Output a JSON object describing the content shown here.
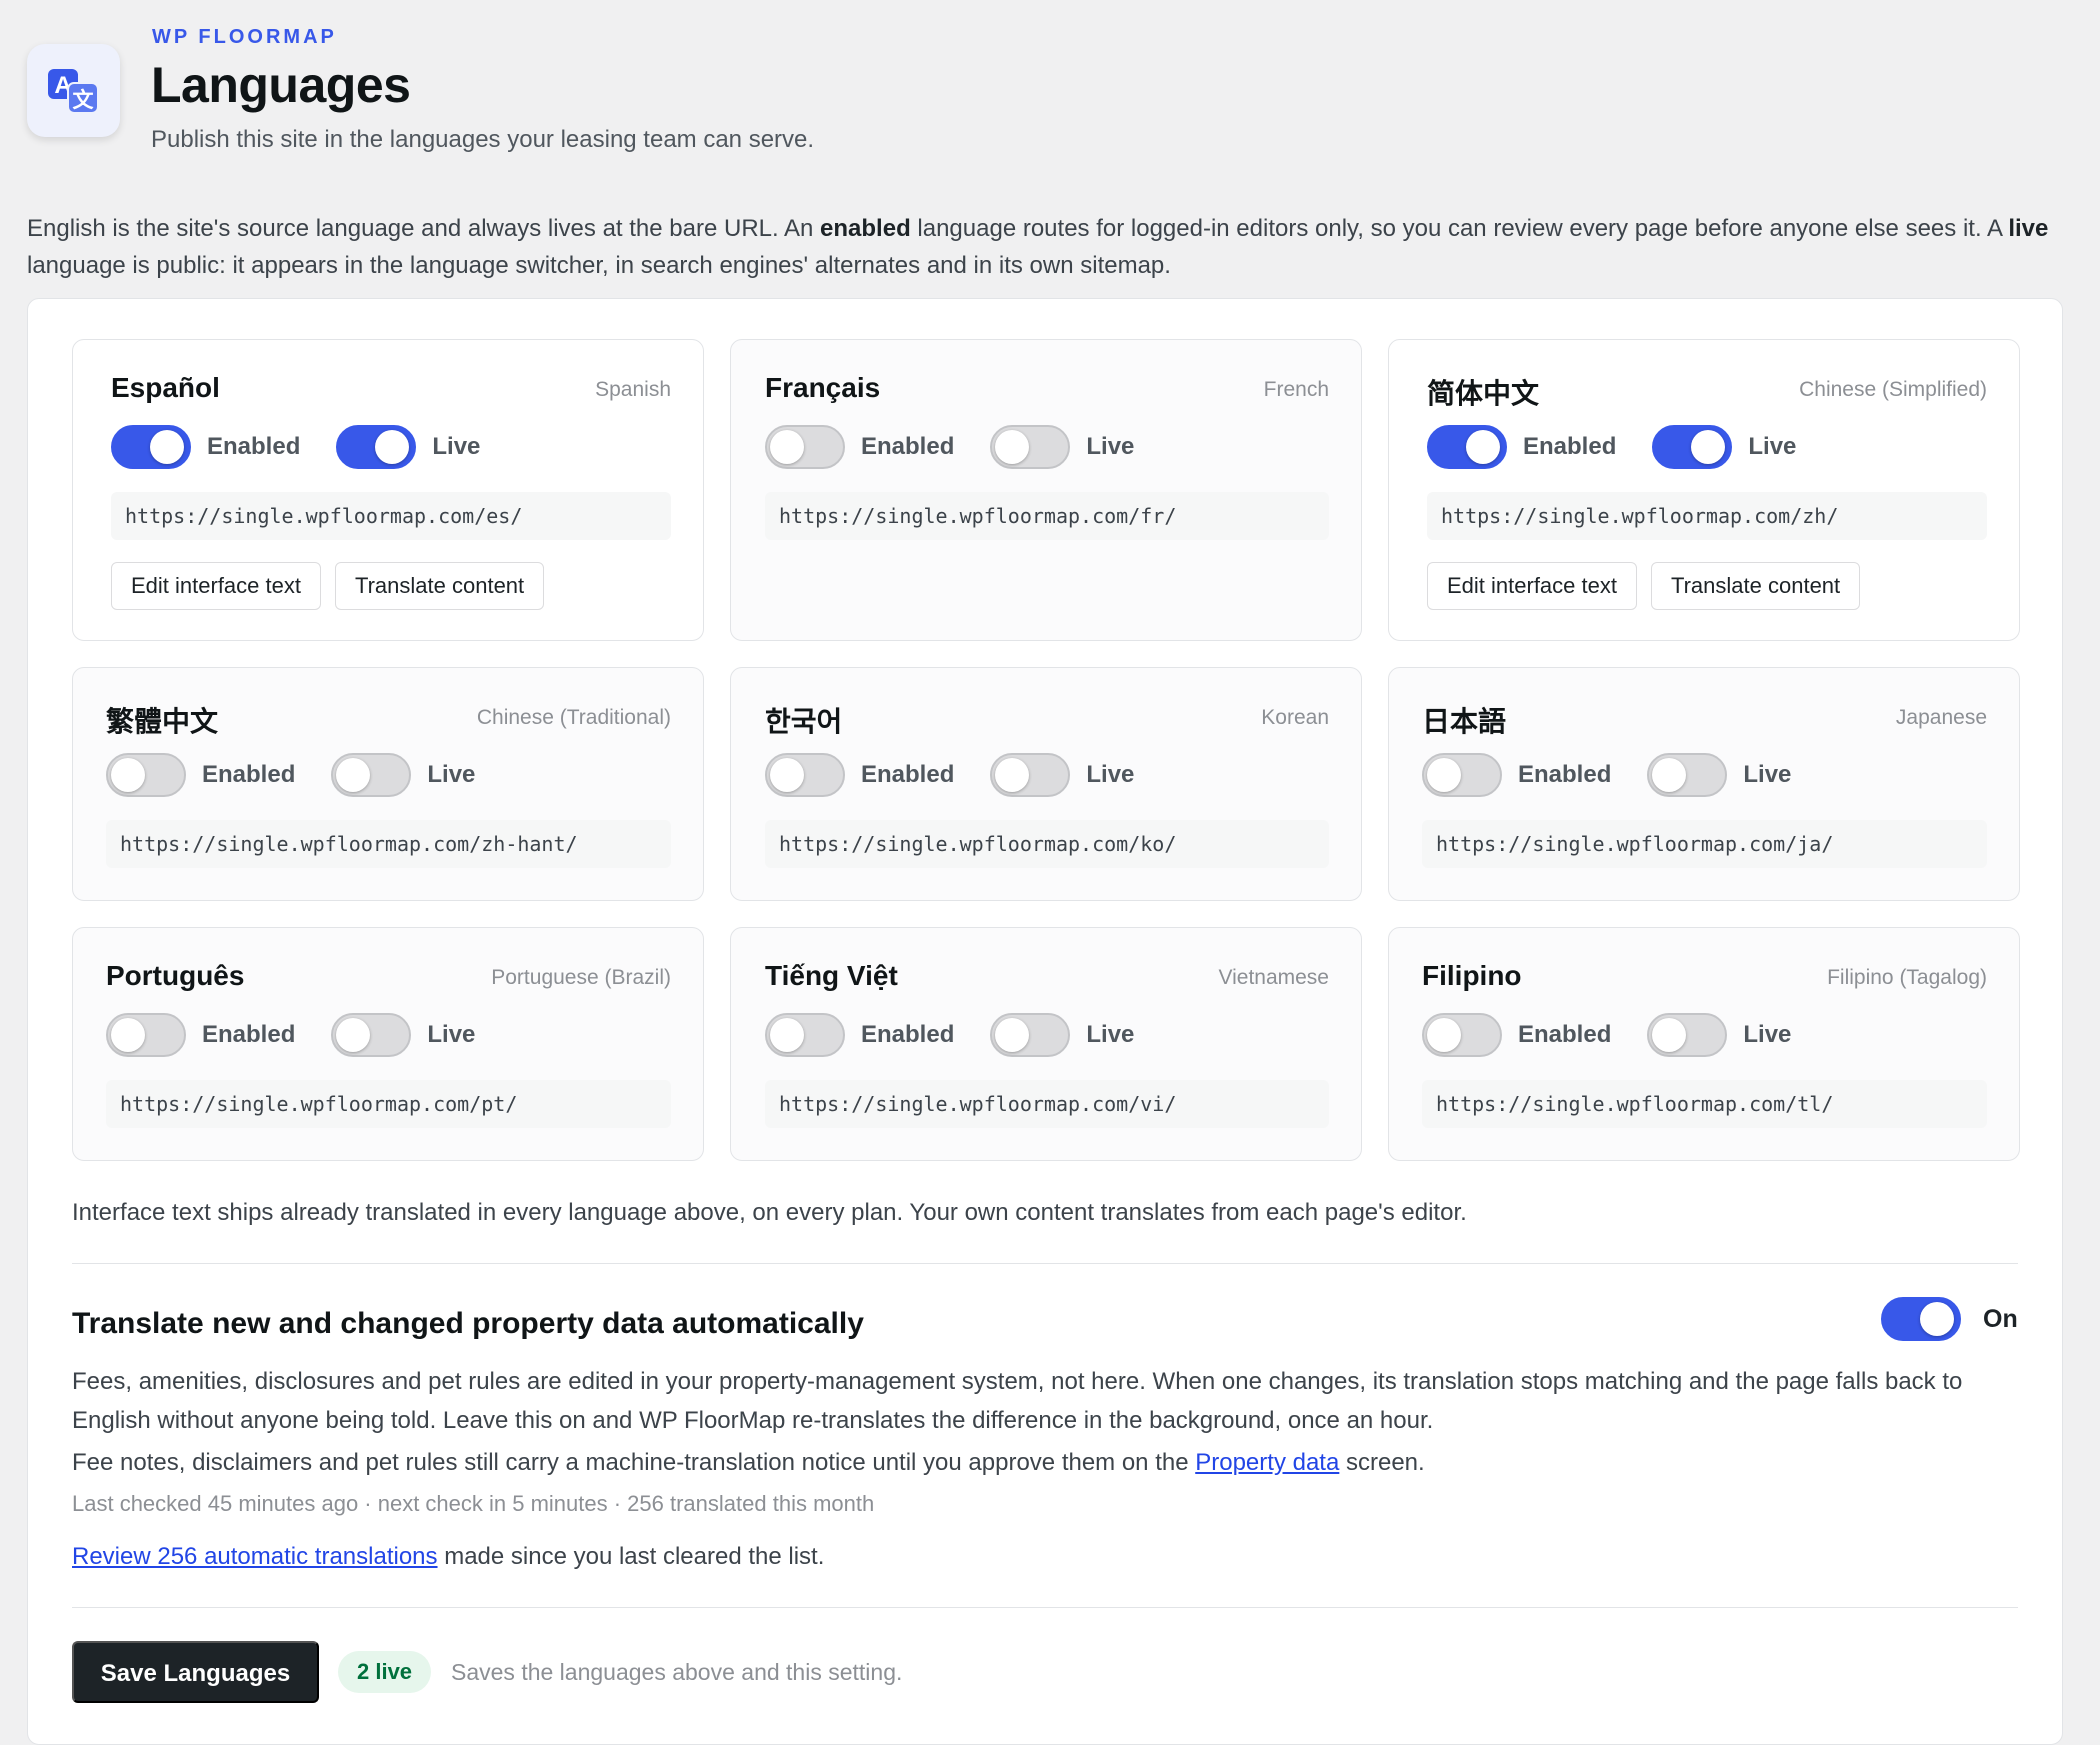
{
  "header": {
    "brand": "WP FLOORMAP",
    "title": "Languages",
    "subtitle": "Publish this site in the languages your leasing team can serve.",
    "icon": "translate-icon"
  },
  "intro": {
    "p1": "English is the site's source language and always lives at the bare URL. An ",
    "b1": "enabled",
    "p2": " language routes for logged-in editors only, so you can review every page before anyone else sees it. A ",
    "b2": "live",
    "p3": " language is public: it appears in the language switcher, in search engines' alternates and in its own sitemap."
  },
  "labels": {
    "enabled": "Enabled",
    "live": "Live",
    "edit_interface": "Edit interface text",
    "translate_content": "Translate content"
  },
  "languages": [
    {
      "name": "Español",
      "english": "Spanish",
      "enabled": true,
      "live": true,
      "url": "https://single.wpfloormap.com/es/"
    },
    {
      "name": "Français",
      "english": "French",
      "enabled": false,
      "live": false,
      "url": "https://single.wpfloormap.com/fr/"
    },
    {
      "name": "简体中文",
      "english": "Chinese (Simplified)",
      "enabled": true,
      "live": true,
      "url": "https://single.wpfloormap.com/zh/"
    },
    {
      "name": "繁體中文",
      "english": "Chinese (Traditional)",
      "enabled": false,
      "live": false,
      "url": "https://single.wpfloormap.com/zh-hant/"
    },
    {
      "name": "한국어",
      "english": "Korean",
      "enabled": false,
      "live": false,
      "url": "https://single.wpfloormap.com/ko/"
    },
    {
      "name": "日本語",
      "english": "Japanese",
      "enabled": false,
      "live": false,
      "url": "https://single.wpfloormap.com/ja/"
    },
    {
      "name": "Português",
      "english": "Portuguese (Brazil)",
      "enabled": false,
      "live": false,
      "url": "https://single.wpfloormap.com/pt/"
    },
    {
      "name": "Tiếng Việt",
      "english": "Vietnamese",
      "enabled": false,
      "live": false,
      "url": "https://single.wpfloormap.com/vi/"
    },
    {
      "name": "Filipino",
      "english": "Filipino (Tagalog)",
      "enabled": false,
      "live": false,
      "url": "https://single.wpfloormap.com/tl/"
    }
  ],
  "note": "Interface text ships already translated in every language above, on every plan. Your own content translates from each page's editor.",
  "auto": {
    "title": "Translate new and changed property data automatically",
    "toggle_on": true,
    "toggle_label": "On",
    "description": "Fees, amenities, disclosures and pet rules are edited in your property-management system, not here. When one changes, its translation stops matching and the page falls back to English without anyone being told. Leave this on and WP FloorMap re-translates the difference in the background, once an hour.",
    "notice_before": "Fee notes, disclaimers and pet rules still carry a machine-translation notice until you approve them on the ",
    "notice_link": "Property data",
    "notice_after": " screen.",
    "meta": "Last checked 45 minutes ago · next check in 5 minutes · 256 translated this month",
    "review_link": "Review 256 automatic translations",
    "review_after": " made since you last cleared the list."
  },
  "footer": {
    "save_label": "Save Languages",
    "live_badge": "2 live",
    "save_help": "Saves the languages above and this setting."
  },
  "colors": {
    "accent": "#3858e9",
    "toggle_off": "#dcdcde",
    "badge_bg": "#e6f6ec",
    "badge_text": "#00703c",
    "primary_button": "#1d2327"
  }
}
